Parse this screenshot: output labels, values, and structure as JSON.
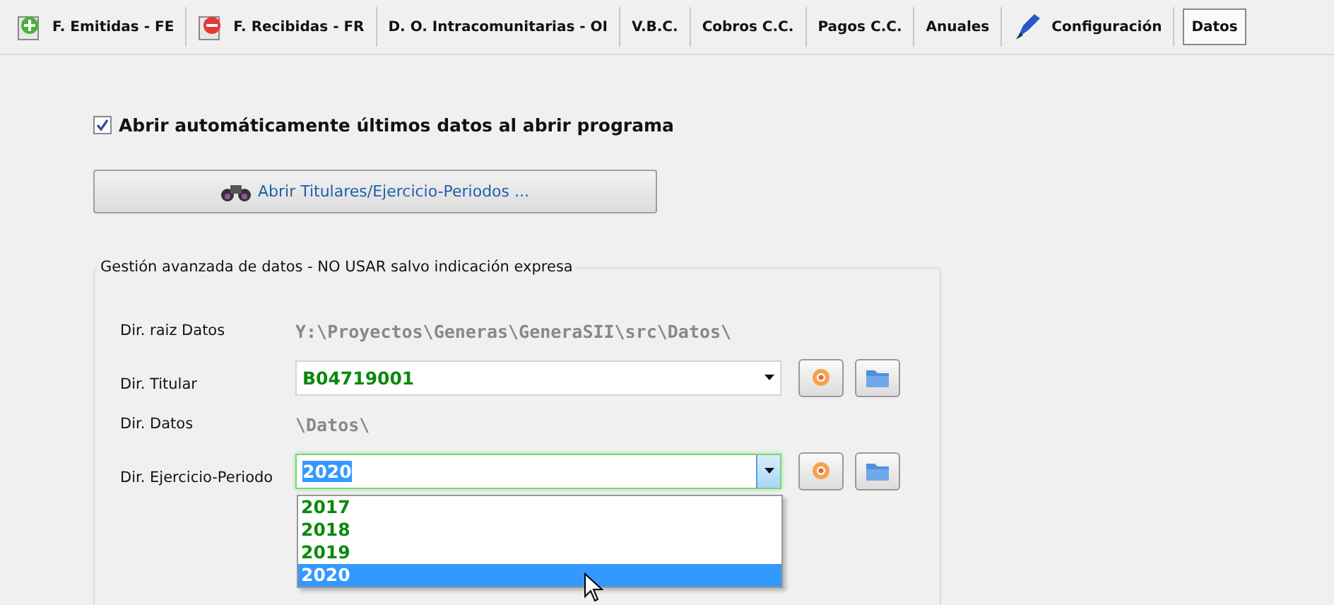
{
  "tabs": [
    {
      "label": "F. Emitidas - FE",
      "kind": "add",
      "selected": false
    },
    {
      "label": "F. Recibidas - FR",
      "kind": "remove",
      "selected": false
    },
    {
      "label": "D. O. Intracomunitarias - OI",
      "kind": "plain",
      "selected": false
    },
    {
      "label": "V.B.C.",
      "kind": "plain",
      "selected": false
    },
    {
      "label": "Cobros C.C.",
      "kind": "plain",
      "selected": false
    },
    {
      "label": "Pagos C.C.",
      "kind": "plain",
      "selected": false
    },
    {
      "label": "Anuales",
      "kind": "plain",
      "selected": false
    },
    {
      "label": "Configuración",
      "kind": "tool",
      "selected": false
    },
    {
      "label": "Datos",
      "kind": "plain",
      "selected": true
    }
  ],
  "auto_open": {
    "label": "Abrir automáticamente últimos datos al abrir programa",
    "checked": true
  },
  "open_button": {
    "label": "Abrir Titulares/Ejercicio-Periodos ..."
  },
  "advanced": {
    "title": "Gestión avanzada de datos - NO USAR salvo indicación expresa",
    "rows": [
      {
        "kind": "text",
        "label": "Dir. raiz Datos",
        "value": "Y:\\Proyectos\\Generas\\GeneraSII\\src\\Datos\\"
      },
      {
        "kind": "combo",
        "label": "Dir. Titular",
        "value": "B04719001",
        "focused": false
      },
      {
        "kind": "text",
        "label": "Dir. Datos",
        "value": "\\Datos\\"
      },
      {
        "kind": "combo",
        "label": "Dir. Ejercicio-Periodo",
        "value": "2020",
        "focused": true,
        "options": [
          {
            "label": "2017",
            "selected": false
          },
          {
            "label": "2018",
            "selected": false
          },
          {
            "label": "2019",
            "selected": false
          },
          {
            "label": "2020",
            "selected": true
          }
        ]
      }
    ]
  }
}
